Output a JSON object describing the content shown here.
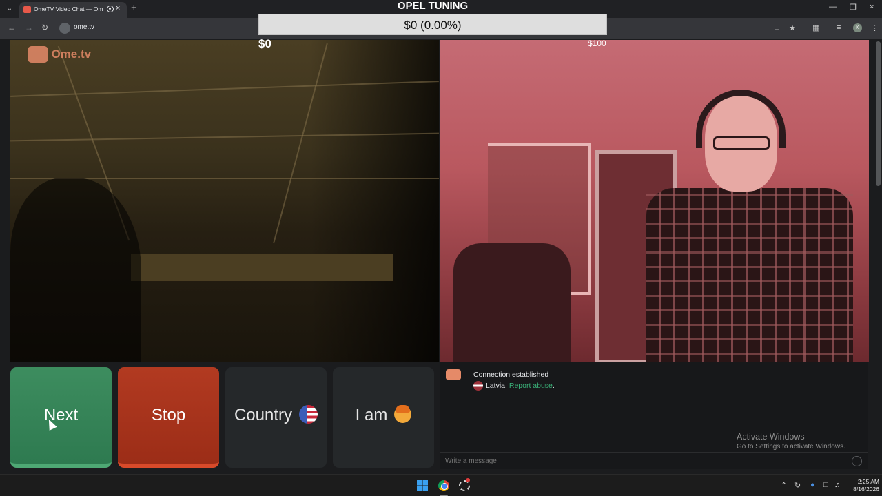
{
  "browser": {
    "tab_title": "OmeTV Video Chat — Ome",
    "url": "ome.tv",
    "profile_initial": "K"
  },
  "overlay": {
    "title": "OPEL TUNING",
    "progress_label": "$0 (0.00%)",
    "progress_fraction": 0.0,
    "start_amount": "$0",
    "goal_amount": "$100"
  },
  "site": {
    "logo_text": "Ome.tv"
  },
  "controls": {
    "next_label": "Next",
    "stop_label": "Stop",
    "country_label": "Country",
    "iam_label": "I am"
  },
  "chat": {
    "status": "Connection established",
    "country": "Latvia.",
    "report_label": "Report abuse",
    "report_suffix": ".",
    "input_placeholder": "Write a message"
  },
  "windows": {
    "activate_title": "Activate Windows",
    "activate_sub": "Go to Settings to activate Windows.",
    "time": "2:25 AM",
    "date": "8/16/2026"
  },
  "colors": {
    "next_green": "#2e7a50",
    "stop_red": "#9c2d17",
    "report_link": "#3bb37a"
  }
}
